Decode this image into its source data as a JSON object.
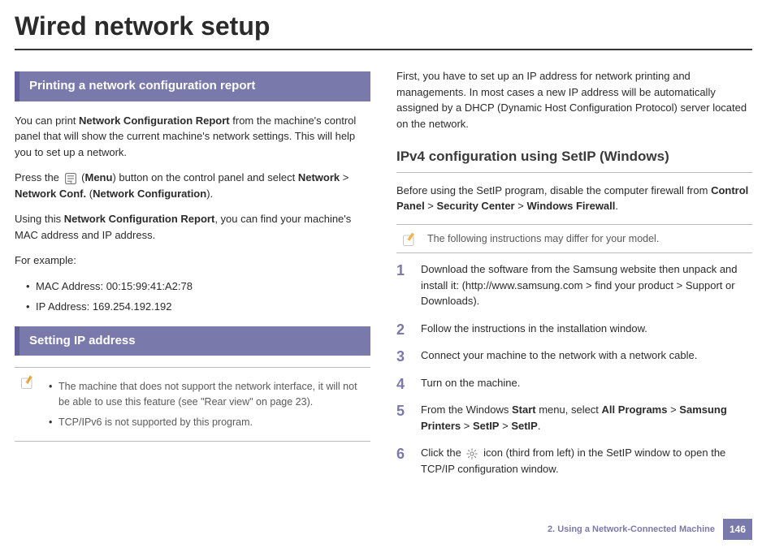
{
  "page_title": "Wired network setup",
  "footer": {
    "chapter": "2.  Using a Network-Connected Machine",
    "page": "146"
  },
  "left": {
    "section1_title": "Printing a network configuration report",
    "p1_a": "You can print ",
    "p1_b": "Network Configuration Report",
    "p1_c": " from the machine's control panel that will show the current machine's network settings. This will help you to set up a network.",
    "p2_a": "Press the ",
    "p2_b": " (",
    "p2_c": "Menu",
    "p2_d": ") button on the control panel and select ",
    "p2_e": "Network",
    "p2_f": " > ",
    "p2_g": "Network Conf.",
    "p2_h": " (",
    "p2_i": "Network Configuration",
    "p2_j": ").",
    "p3_a": "Using this ",
    "p3_b": "Network Configuration Report",
    "p3_c": ", you can find your machine's MAC address and IP address.",
    "p4": "For example:",
    "bullets": [
      "MAC Address: 00:15:99:41:A2:78",
      "IP Address: 169.254.192.192"
    ],
    "section2_title": "Setting IP address",
    "note_items": [
      "The machine that does not support the network interface, it will not be able to use this feature (see \"Rear view\" on page 23).",
      "TCP/IPv6 is not supported by this program."
    ]
  },
  "right": {
    "intro": "First, you have to set up an IP address for network printing and managements. In most cases a new IP address will be automatically assigned by a DHCP (Dynamic Host Configuration Protocol) server located on the network.",
    "subheading": "IPv4 configuration using SetIP (Windows)",
    "p1_a": "Before using the SetIP program, disable the computer firewall from ",
    "p1_b": "Control Panel",
    "p1_c": " > ",
    "p1_d": "Security Center",
    "p1_e": " > ",
    "p1_f": "Windows Firewall",
    "p1_g": ".",
    "note": "The following instructions may differ for your model.",
    "steps": {
      "s1": "Download the software from the Samsung website then unpack and install it: (http://www.samsung.com > find your product > Support or Downloads).",
      "s2": "Follow the instructions in the installation window.",
      "s3": "Connect your machine to the network with a network cable.",
      "s4": "Turn on the machine.",
      "s5_a": "From the Windows ",
      "s5_b": "Start",
      "s5_c": " menu, select ",
      "s5_d": "All Programs",
      "s5_e": " > ",
      "s5_f": "Samsung Printers",
      "s5_g": " > ",
      "s5_h": "SetIP",
      "s5_i": " > ",
      "s5_j": "SetIP",
      "s5_k": ".",
      "s6_a": "Click the ",
      "s6_b": " icon (third from left) in the SetIP window to open the TCP/IP configuration window."
    }
  }
}
